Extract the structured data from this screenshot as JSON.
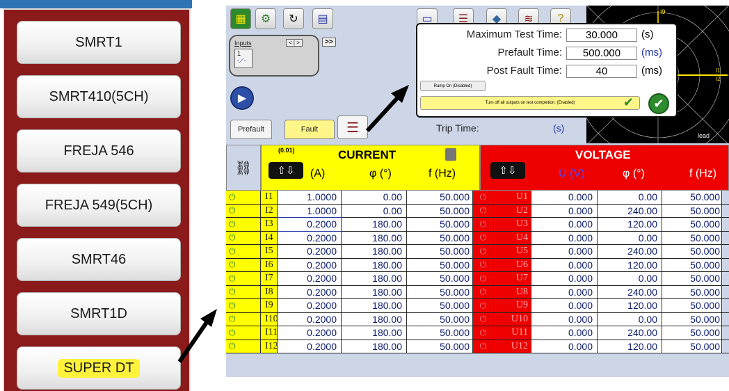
{
  "devices": [
    "SMRT1",
    "SMRT410(5CH)",
    "FREJA 546",
    "FREJA 549(5CH)",
    "SMRT46",
    "SMRT1D",
    "SUPER DT"
  ],
  "toolbar": {
    "inputs_label": "Inputs",
    "input_number": "1",
    "nav_prev": "<",
    "nav_next": ">",
    "fast_forward": ">>"
  },
  "tabs": {
    "prefault": "Prefault",
    "fault": "Fault"
  },
  "trip": {
    "label": "Trip Time:",
    "unit": "(s)"
  },
  "popup": {
    "max_test_time_label": "Maximum Test Time:",
    "max_test_time_value": "30.000",
    "max_test_time_unit": "(s)",
    "prefault_time_label": "Prefault Time:",
    "prefault_time_value": "500.000",
    "prefault_time_unit": "(ms)",
    "post_fault_time_label": "Post Fault Time:",
    "post_fault_time_value": "40",
    "post_fault_time_unit": "(ms)",
    "ramp_label": "Ramp On (Disabled)",
    "turn_off_label": "Turn off all outputs on test completion: (Enabled)"
  },
  "polar": {
    "top_label": "I9",
    "right_label_1": "I1",
    "right_label_2": "I2",
    "bottom_label": "lead"
  },
  "table": {
    "current_title": "CURRENT",
    "voltage_title": "VOLTAGE",
    "step": "(0.01)",
    "cur_amp_header": "(A)",
    "cur_phase_header": "φ  (°)",
    "cur_freq_header": "f  (Hz)",
    "vol_amp_header": "U (V)",
    "vol_phase_header": "φ  (°)",
    "vol_freq_header": "f  (Hz)",
    "rows": [
      {
        "i": "I1",
        "ia": "1.0000",
        "ip": "0.00",
        "if": "50.000",
        "u": "U1",
        "ua": "0.000",
        "up": "0.00",
        "uf": "50.000"
      },
      {
        "i": "I2",
        "ia": "1.0000",
        "ip": "0.00",
        "if": "50.000",
        "u": "U2",
        "ua": "0.000",
        "up": "240.00",
        "uf": "50.000"
      },
      {
        "i": "I3",
        "ia": "0.2000",
        "ip": "180.00",
        "if": "50.000",
        "u": "U3",
        "ua": "0.000",
        "up": "120.00",
        "uf": "50.000"
      },
      {
        "i": "I4",
        "ia": "0.2000",
        "ip": "180.00",
        "if": "50.000",
        "u": "U4",
        "ua": "0.000",
        "up": "0.00",
        "uf": "50.000"
      },
      {
        "i": "I5",
        "ia": "0.2000",
        "ip": "180.00",
        "if": "50.000",
        "u": "U5",
        "ua": "0.000",
        "up": "240.00",
        "uf": "50.000"
      },
      {
        "i": "I6",
        "ia": "0.2000",
        "ip": "180.00",
        "if": "50.000",
        "u": "U6",
        "ua": "0.000",
        "up": "120.00",
        "uf": "50.000"
      },
      {
        "i": "I7",
        "ia": "0.2000",
        "ip": "180.00",
        "if": "50.000",
        "u": "U7",
        "ua": "0.000",
        "up": "0.00",
        "uf": "50.000"
      },
      {
        "i": "I8",
        "ia": "0.2000",
        "ip": "180.00",
        "if": "50.000",
        "u": "U8",
        "ua": "0.000",
        "up": "240.00",
        "uf": "50.000"
      },
      {
        "i": "I9",
        "ia": "0.2000",
        "ip": "180.00",
        "if": "50.000",
        "u": "U9",
        "ua": "0.000",
        "up": "120.00",
        "uf": "50.000"
      },
      {
        "i": "I10",
        "ia": "0.2000",
        "ip": "180.00",
        "if": "50.000",
        "u": "U10",
        "ua": "0.000",
        "up": "0.00",
        "uf": "50.000"
      },
      {
        "i": "I11",
        "ia": "0.2000",
        "ip": "180.00",
        "if": "50.000",
        "u": "U11",
        "ua": "0.000",
        "up": "240.00",
        "uf": "50.000"
      },
      {
        "i": "I12",
        "ia": "0.2000",
        "ip": "180.00",
        "if": "50.000",
        "u": "U12",
        "ua": "0.000",
        "up": "120.00",
        "uf": "50.000"
      }
    ]
  }
}
